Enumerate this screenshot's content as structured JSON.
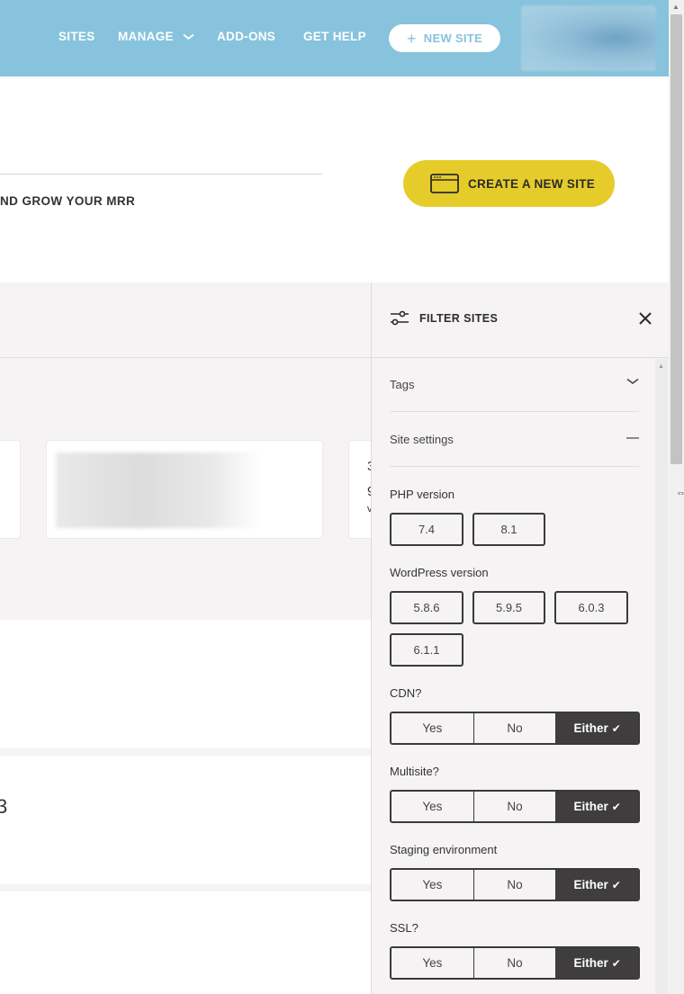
{
  "nav": {
    "links": [
      "SITES",
      "MANAGE",
      "ADD-ONS",
      "GET HELP"
    ],
    "new_site_label": "NEW SITE",
    "bg_color": "#87c3dc"
  },
  "hero": {
    "tagline": "ND GROW YOUR MRR",
    "create_label": "CREATE A NEW SITE",
    "create_color": "#e6cc2a"
  },
  "main": {
    "card_c_lines": [
      "3",
      "9",
      "v"
    ],
    "section2_number": "3"
  },
  "filter_panel": {
    "title": "FILTER SITES",
    "tags_label": "Tags",
    "site_settings_label": "Site settings",
    "php": {
      "label": "PHP version",
      "options": [
        "7.4",
        "8.1"
      ]
    },
    "wordpress": {
      "label": "WordPress version",
      "options": [
        "5.8.6",
        "5.9.5",
        "6.0.3",
        "6.1.1"
      ]
    },
    "cdn": {
      "label": "CDN?",
      "yes": "Yes",
      "no": "No",
      "either": "Either",
      "selected": "Either"
    },
    "multisite": {
      "label": "Multisite?",
      "yes": "Yes",
      "no": "No",
      "either": "Either",
      "selected": "Either"
    },
    "staging": {
      "label": "Staging environment",
      "yes": "Yes",
      "no": "No",
      "either": "Either",
      "selected": "Either"
    },
    "ssl": {
      "label": "SSL?",
      "yes": "Yes",
      "no": "No",
      "either": "Either",
      "selected": "Either"
    }
  }
}
